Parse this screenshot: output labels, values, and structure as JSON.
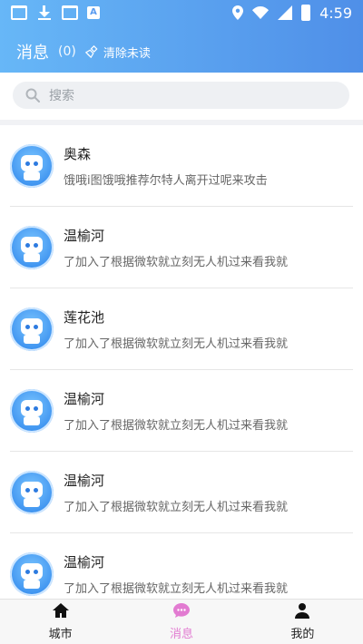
{
  "status_bar": {
    "time": "4:59",
    "left_icons": [
      "tray-icon",
      "download-icon",
      "tray-icon",
      "app-a-icon"
    ],
    "right_icons": [
      "location-pin-icon",
      "wifi-icon",
      "signal-icon",
      "battery-icon"
    ],
    "app_icon_letter": "A"
  },
  "header": {
    "title": "消息",
    "unread_count": "(0)",
    "clear_label": "清除未读",
    "gradient_from": "#67b7f7",
    "gradient_to": "#4f8fe8"
  },
  "search": {
    "placeholder": "搜索"
  },
  "conversations": [
    {
      "name": "奥森",
      "message": "饿哦i图饿哦推荐尔特人离开过呢来攻击"
    },
    {
      "name": "温榆河",
      "message": "了加入了根据微软就立刻无人机过来看我就"
    },
    {
      "name": "莲花池",
      "message": "了加入了根据微软就立刻无人机过来看我就"
    },
    {
      "name": "温榆河",
      "message": "了加入了根据微软就立刻无人机过来看我就"
    },
    {
      "name": "温榆河",
      "message": "了加入了根据微软就立刻无人机过来看我就"
    },
    {
      "name": "温榆河",
      "message": "了加入了根据微软就立刻无人机过来看我就"
    }
  ],
  "bottom_nav": {
    "tabs": [
      {
        "label": "城市",
        "icon": "home-icon"
      },
      {
        "label": "消息",
        "icon": "chat-bubble-icon",
        "active": true
      },
      {
        "label": "我的",
        "icon": "person-icon"
      }
    ],
    "active_color": "#e27bd1"
  }
}
